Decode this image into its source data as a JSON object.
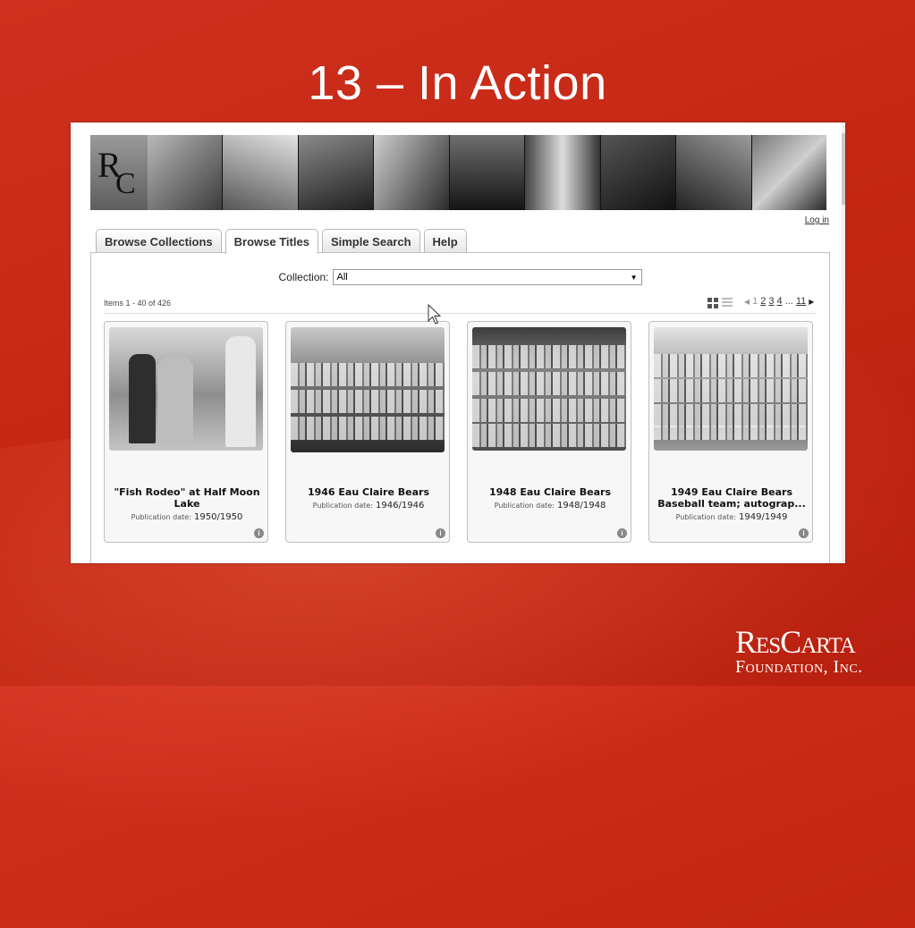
{
  "slide": {
    "title": "13 – In Action",
    "logo": {
      "line1": "ResCarta",
      "line2": "Foundation, Inc."
    }
  },
  "banner": {
    "logo_letters": [
      "R",
      "C"
    ]
  },
  "header": {
    "login_label": "Log in"
  },
  "tabs": [
    {
      "label": "Browse Collections",
      "active": false
    },
    {
      "label": "Browse Titles",
      "active": true
    },
    {
      "label": "Simple Search",
      "active": false
    },
    {
      "label": "Help",
      "active": false
    }
  ],
  "collection": {
    "label": "Collection:",
    "selected": "All"
  },
  "results": {
    "count_text": "Items 1 - 40 of 426"
  },
  "pager": {
    "pages": [
      "1",
      "2",
      "3",
      "4",
      "11"
    ],
    "ellipsis": "..."
  },
  "cards": [
    {
      "title": "\"Fish Rodeo\" at Half Moon Lake",
      "date_label": "Publication date:",
      "date": "1950/1950"
    },
    {
      "title": "1946 Eau Claire Bears",
      "date_label": "Publication date:",
      "date": "1946/1946"
    },
    {
      "title": "1948 Eau Claire Bears",
      "date_label": "Publication date:",
      "date": "1948/1948"
    },
    {
      "title": "1949 Eau Claire Bears Baseball team; autograp...",
      "date_label": "Publication date:",
      "date": "1949/1949"
    }
  ],
  "colors": {
    "slide_red": "#c42814",
    "text_white": "#ffffff",
    "info_grey": "#888888"
  }
}
